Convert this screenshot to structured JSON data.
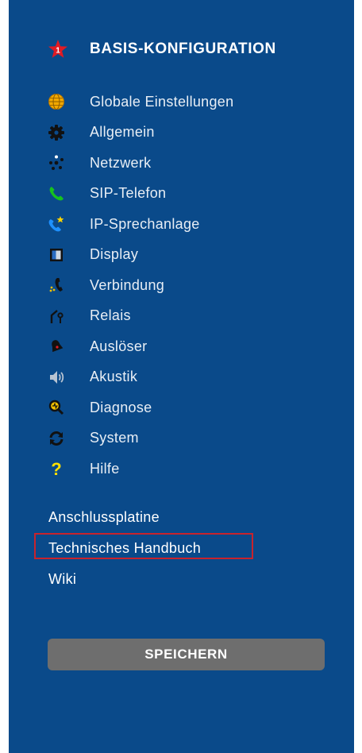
{
  "sidebar": {
    "header": {
      "title": "BASIS-KONFIGURATION",
      "badge": "1"
    },
    "items": [
      {
        "label": "Globale Einstellungen",
        "icon": "globe-icon"
      },
      {
        "label": "Allgemein",
        "icon": "gear-icon"
      },
      {
        "label": "Netzwerk",
        "icon": "network-icon"
      },
      {
        "label": "SIP-Telefon",
        "icon": "phone-icon"
      },
      {
        "label": "IP-Sprechanlage",
        "icon": "intercom-phone-icon"
      },
      {
        "label": "Display",
        "icon": "display-icon"
      },
      {
        "label": "Verbindung",
        "icon": "connection-icon"
      },
      {
        "label": "Relais",
        "icon": "relay-icon"
      },
      {
        "label": "Auslöser",
        "icon": "trigger-bell-icon"
      },
      {
        "label": "Akustik",
        "icon": "speaker-icon"
      },
      {
        "label": "Diagnose",
        "icon": "diagnosis-magnifier-icon"
      },
      {
        "label": "System",
        "icon": "refresh-icon"
      },
      {
        "label": "Hilfe",
        "icon": "help-icon"
      }
    ],
    "links": [
      {
        "label": "Anschlussplatine"
      },
      {
        "label": "Technisches Handbuch"
      },
      {
        "label": "Wiki"
      }
    ],
    "save_label": "SPEICHERN"
  },
  "colors": {
    "panel": "#0a4a8a",
    "highlight": "#c8232c",
    "save_button": "#6e6e6e"
  }
}
